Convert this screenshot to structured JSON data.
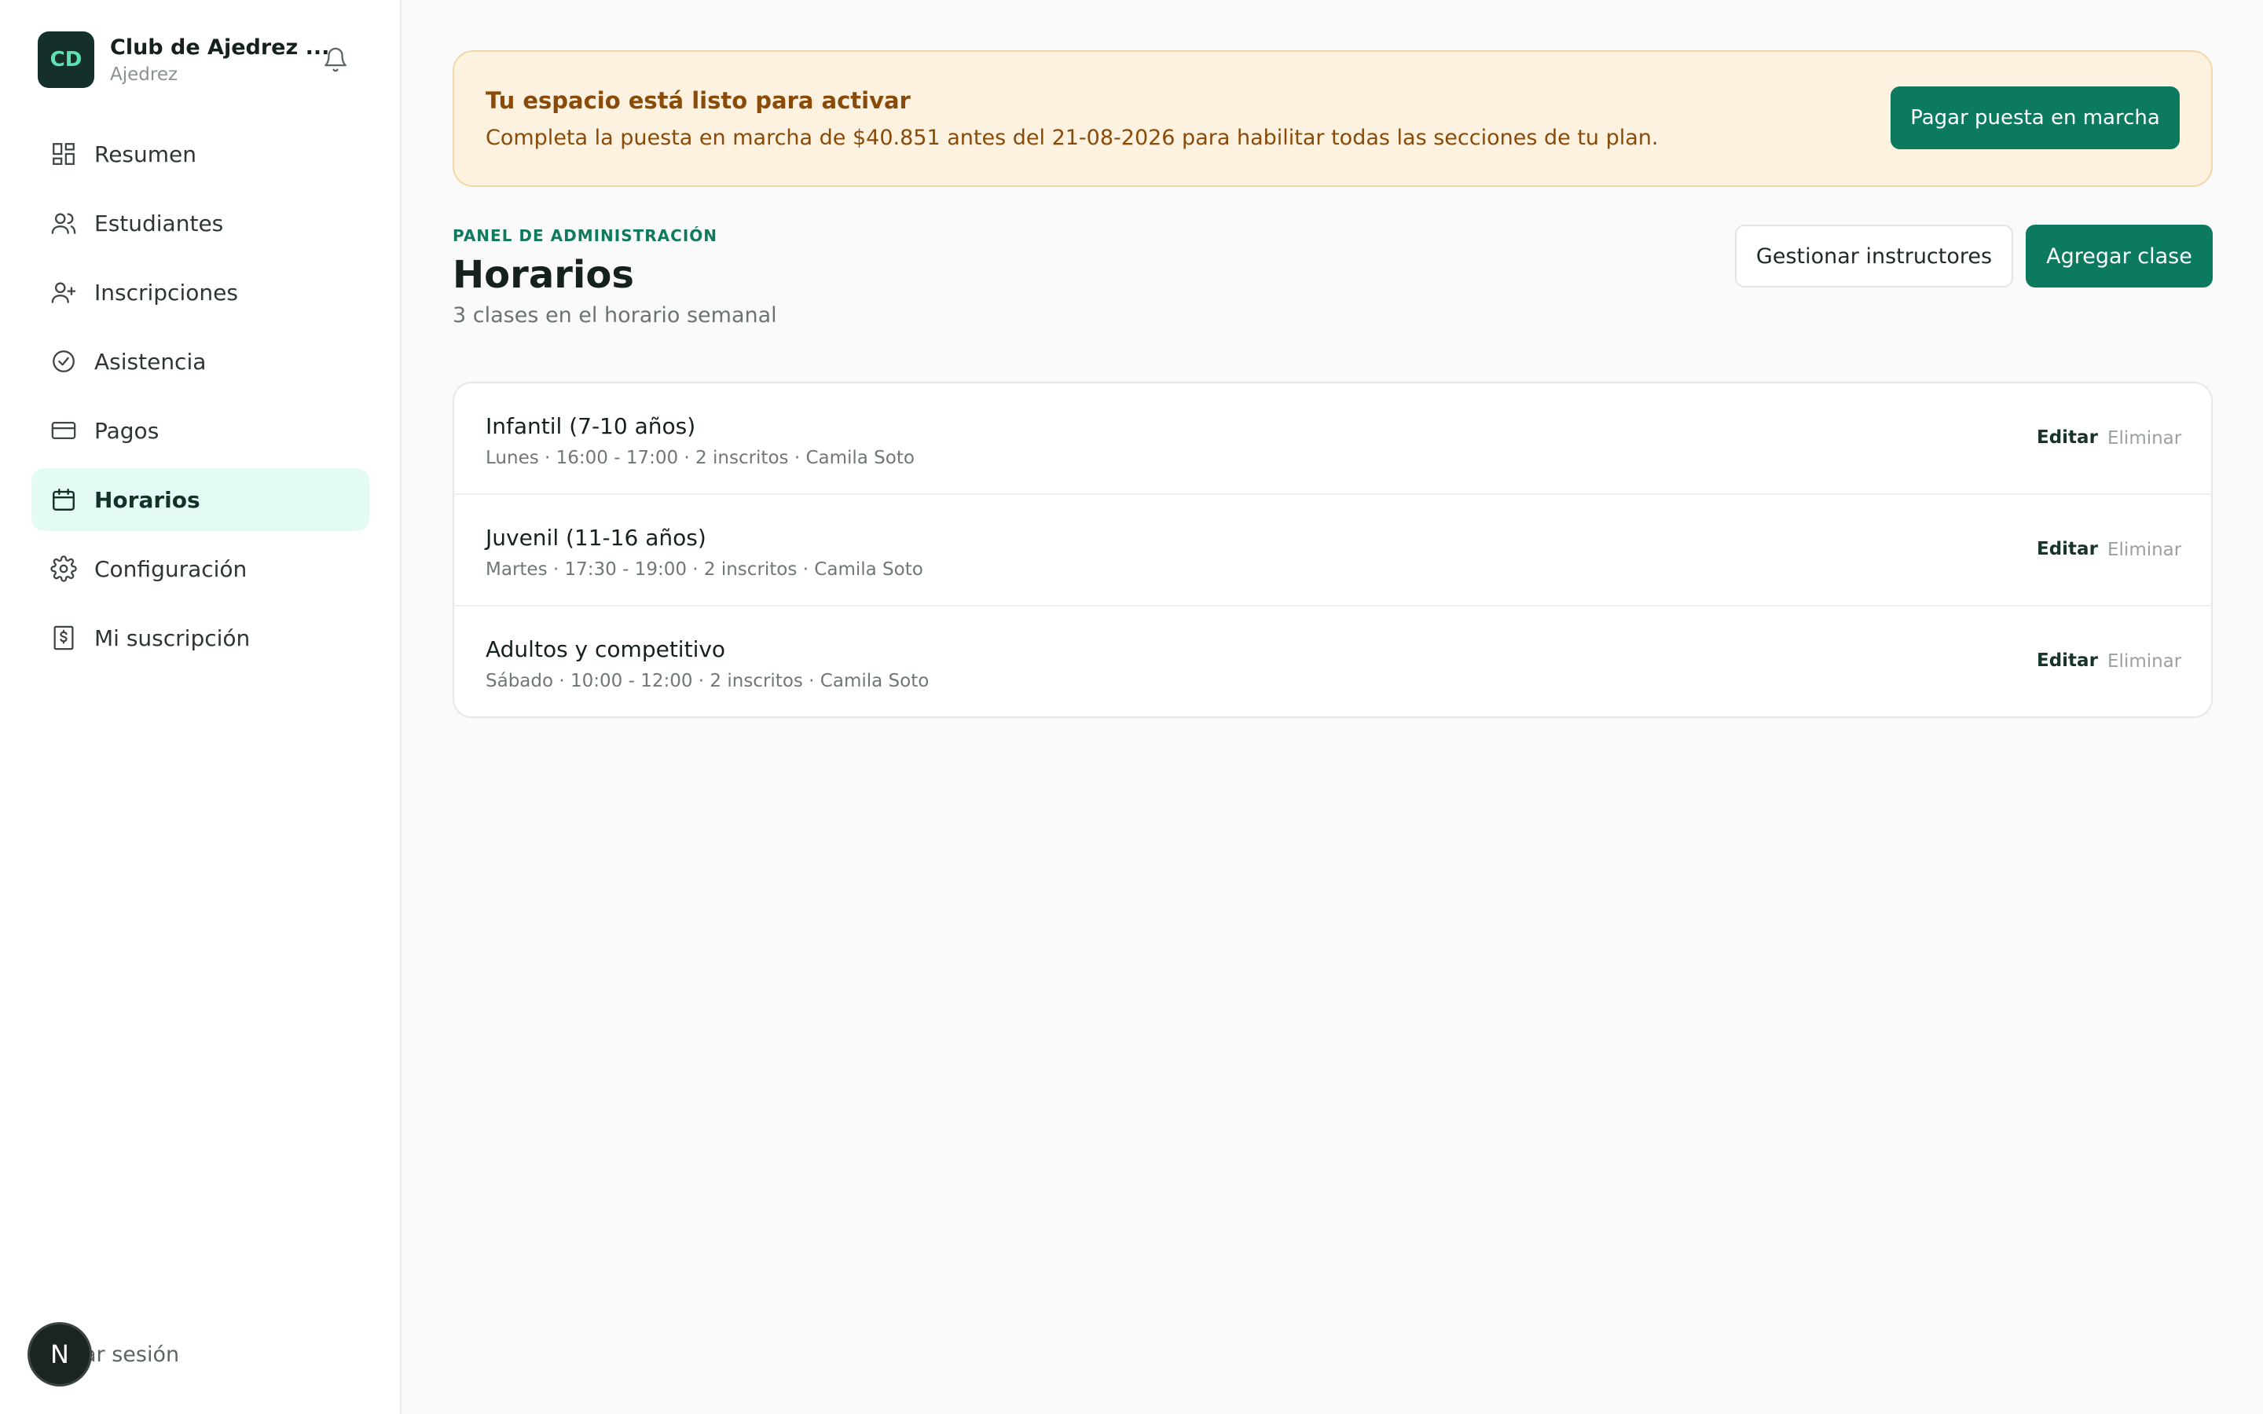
{
  "sidebar": {
    "brand": {
      "initials": "CD",
      "name": "Club de Ajedrez ...",
      "subtitle": "Ajedrez"
    },
    "items": [
      {
        "label": "Resumen",
        "icon": "dashboard-icon"
      },
      {
        "label": "Estudiantes",
        "icon": "users-icon"
      },
      {
        "label": "Inscripciones",
        "icon": "user-plus-icon"
      },
      {
        "label": "Asistencia",
        "icon": "check-circle-icon"
      },
      {
        "label": "Pagos",
        "icon": "credit-card-icon"
      },
      {
        "label": "Horarios",
        "icon": "calendar-icon",
        "active": true
      },
      {
        "label": "Configuración",
        "icon": "gear-icon"
      },
      {
        "label": "Mi suscripción",
        "icon": "receipt-dollar-icon"
      }
    ],
    "logout": {
      "avatar": "N",
      "label": "ar sesión"
    }
  },
  "banner": {
    "title": "Tu espacio está listo para activar",
    "text": "Completa la puesta en marcha de $40.851 antes del 21-08-2026 para habilitar todas las secciones de tu plan.",
    "button": "Pagar puesta en marcha"
  },
  "header": {
    "eyebrow": "PANEL DE ADMINISTRACIÓN",
    "title": "Horarios",
    "subtitle": "3 clases en el horario semanal",
    "manage_button": "Gestionar instructores",
    "add_button": "Agregar clase"
  },
  "classes": [
    {
      "name": "Infantil (7-10 años)",
      "meta": "Lunes · 16:00 - 17:00 · 2 inscritos · Camila Soto",
      "edit": "Editar",
      "delete": "Eliminar"
    },
    {
      "name": "Juvenil (11-16 años)",
      "meta": "Martes · 17:30 - 19:00 · 2 inscritos · Camila Soto",
      "edit": "Editar",
      "delete": "Eliminar"
    },
    {
      "name": "Adultos y competitivo",
      "meta": "Sábado · 10:00 - 12:00 · 2 inscritos · Camila Soto",
      "edit": "Editar",
      "delete": "Eliminar"
    }
  ],
  "colors": {
    "accent": "#0c7a5f",
    "active_bg": "#e3fbf3",
    "banner_bg": "#fdf1e0",
    "banner_text": "#8a4a08"
  }
}
